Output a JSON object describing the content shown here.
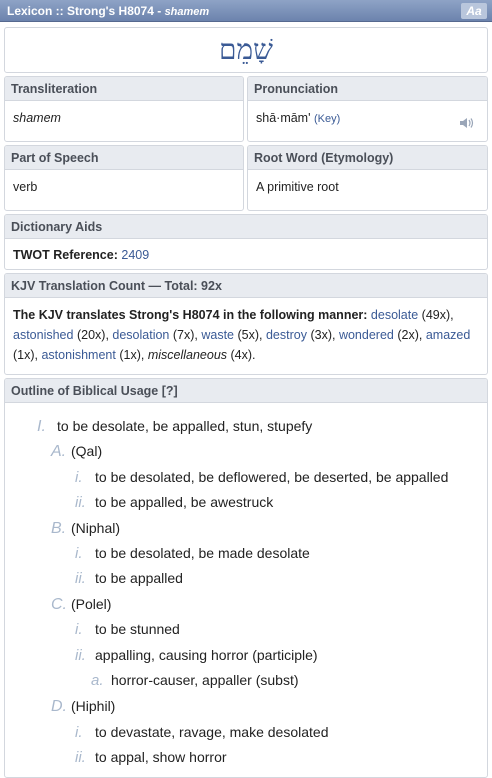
{
  "header": {
    "title": "Lexicon :: Strong's H8074 - ",
    "title_word": "shamem",
    "font_button": "Aa"
  },
  "hebrew_word": "שָׁמֵם",
  "transliteration": {
    "label": "Transliteration",
    "value": "shamem"
  },
  "pronunciation": {
    "label": "Pronunciation",
    "value": "shā·mām'",
    "key_link": "(Key)"
  },
  "part_of_speech": {
    "label": "Part of Speech",
    "value": "verb"
  },
  "root_word": {
    "label": "Root Word (Etymology)",
    "value": "A primitive root"
  },
  "dictionary_aids": {
    "label": "Dictionary Aids",
    "twot_label": "TWOT Reference:",
    "twot_value": "2409"
  },
  "kjv": {
    "label": "KJV Translation Count — Total: 92x",
    "intro": "The KJV translates Strong's H8074 in the following manner:",
    "items": [
      {
        "word": "desolate",
        "count": "(49x)"
      },
      {
        "word": "astonished",
        "count": "(20x)"
      },
      {
        "word": "desolation",
        "count": "(7x)"
      },
      {
        "word": "waste",
        "count": "(5x)"
      },
      {
        "word": "destroy",
        "count": "(3x)"
      },
      {
        "word": "wondered",
        "count": "(2x)"
      },
      {
        "word": "amazed",
        "count": "(1x)"
      },
      {
        "word": "astonishment",
        "count": "(1x)"
      }
    ],
    "misc": "miscellaneous",
    "misc_count": "(4x)."
  },
  "outline": {
    "label": "Outline of Biblical Usage [?]",
    "rows": [
      {
        "marker": "I.",
        "text": "to be desolate, be appalled, stun, stupefy"
      },
      {
        "marker": "A.",
        "text": "(Qal)"
      },
      {
        "marker": "i.",
        "text": "to be desolated, be deflowered, be deserted, be appalled"
      },
      {
        "marker": "ii.",
        "text": "to be appalled, be awestruck"
      },
      {
        "marker": "B.",
        "text": "(Niphal)"
      },
      {
        "marker": "i.",
        "text": "to be desolated, be made desolate"
      },
      {
        "marker": "ii.",
        "text": "to be appalled"
      },
      {
        "marker": "C.",
        "text": "(Polel)"
      },
      {
        "marker": "i.",
        "text": "to be stunned"
      },
      {
        "marker": "ii.",
        "text": "appalling, causing horror (participle)"
      },
      {
        "marker": "a.",
        "text": "horror-causer, appaller (subst)"
      },
      {
        "marker": "D.",
        "text": "(Hiphil)"
      },
      {
        "marker": "i.",
        "text": "to devastate, ravage, make desolated"
      },
      {
        "marker": "ii.",
        "text": "to appal, show horror"
      }
    ]
  }
}
